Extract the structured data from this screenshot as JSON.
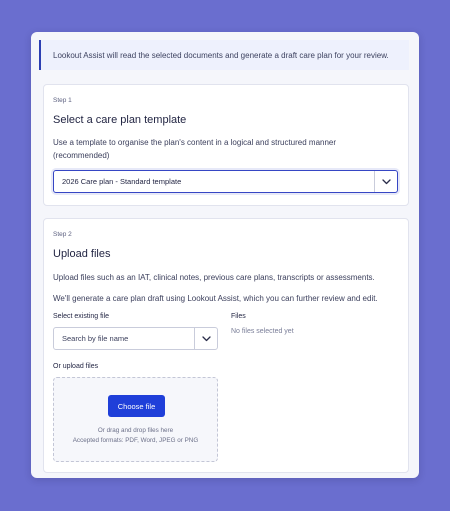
{
  "banner": {
    "text": "Lookout Assist will read the selected documents and generate a draft care plan for your review."
  },
  "step1": {
    "step_label": "Step 1",
    "title": "Select a care plan template",
    "description": "Use a template to organise the plan's content in a logical and structured manner (recommended)",
    "template_select": {
      "selected": "2026 Care plan - Standard template"
    }
  },
  "step2": {
    "step_label": "Step 2",
    "title": "Upload files",
    "description": "Upload files such as an IAT, clinical notes, previous care plans, transcripts or assessments.",
    "description2": "We'll generate a care plan draft using Lookout Assist, which you can further review and edit.",
    "existing_file_label": "Select existing file",
    "search_placeholder": "Search by file name",
    "files_label": "Files",
    "no_files_text": "No files selected yet",
    "upload_label": "Or upload files",
    "choose_button": "Choose file",
    "drag_hint": "Or drag and drop files here",
    "formats_hint": "Accepted formats: PDF, Word, JPEG or PNG"
  },
  "icons": {
    "dropdown": "chevron-down-icon"
  },
  "colors": {
    "background": "#6a6ecf",
    "accent": "#1f3fd9",
    "banner_border": "#2c3fb3"
  }
}
